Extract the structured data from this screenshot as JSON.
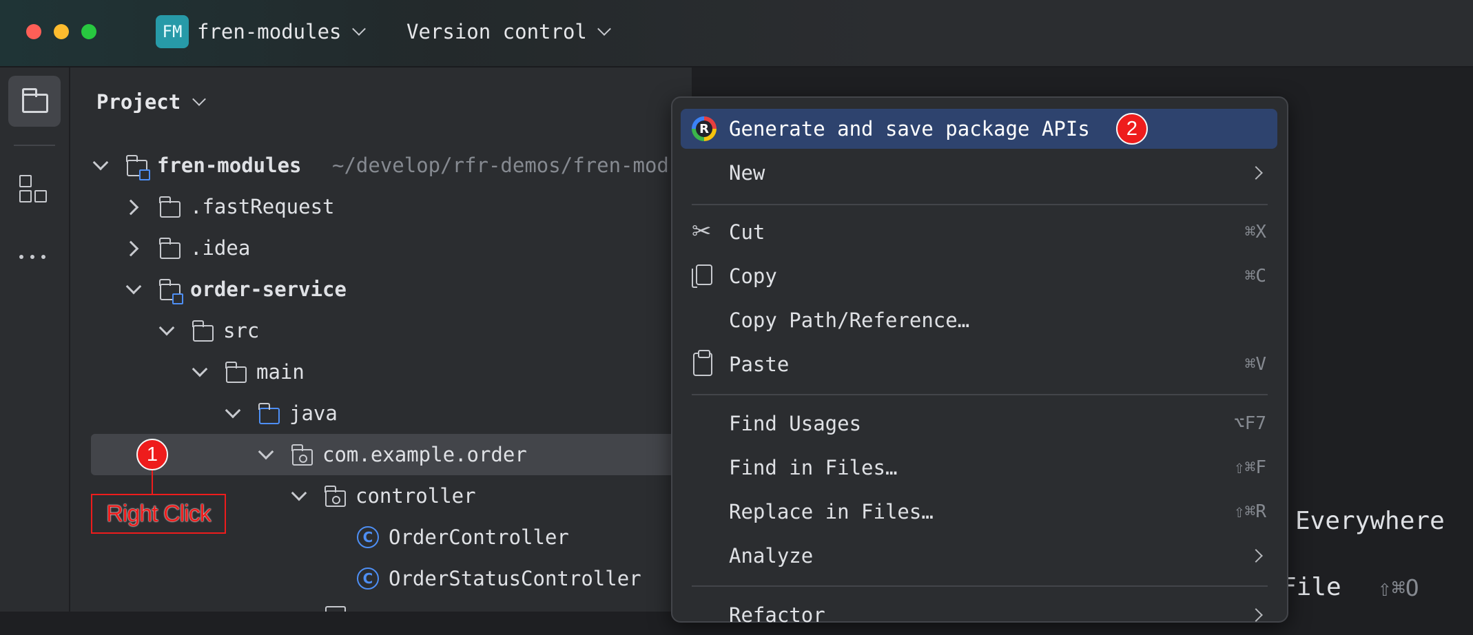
{
  "titlebar": {
    "project_badge": "FM",
    "project_name": "fren-modules",
    "vcs_label": "Version control"
  },
  "project_panel": {
    "title": "Project",
    "tree": [
      {
        "label": "fren-modules",
        "path_hint": "~/develop/rfr-demos/fren-mod"
      },
      {
        "label": ".fastRequest"
      },
      {
        "label": ".idea"
      },
      {
        "label": "order-service"
      },
      {
        "label": "src"
      },
      {
        "label": "main"
      },
      {
        "label": "java"
      },
      {
        "label": "com.example.order"
      },
      {
        "label": "controller"
      },
      {
        "label": "OrderController"
      },
      {
        "label": "OrderStatusController"
      }
    ]
  },
  "annotations": {
    "step1_number": "1",
    "step1_text": "Right Click",
    "step2_number": "2"
  },
  "context_menu": {
    "items": [
      {
        "label": "Generate and save package APIs",
        "shortcut": ""
      },
      {
        "label": "New",
        "shortcut": ""
      },
      {
        "label": "Cut",
        "shortcut": "⌘X"
      },
      {
        "label": "Copy",
        "shortcut": "⌘C"
      },
      {
        "label": "Copy Path/Reference…",
        "shortcut": ""
      },
      {
        "label": "Paste",
        "shortcut": "⌘V"
      },
      {
        "label": "Find Usages",
        "shortcut": "⌥F7"
      },
      {
        "label": "Find in Files…",
        "shortcut": "⇧⌘F"
      },
      {
        "label": "Replace in Files…",
        "shortcut": "⇧⌘R"
      },
      {
        "label": "Analyze",
        "shortcut": ""
      },
      {
        "label": "Refactor",
        "shortcut": ""
      }
    ]
  },
  "editor_hints": {
    "search_everywhere_tail": "Everywhere",
    "goto_file_tail": "File",
    "goto_file_shortcut": "⇧⌘O"
  },
  "colors": {
    "accent_selected": "#2e436e",
    "badge_red": "#ee1c1c",
    "project_badge_bg": "#279aa8"
  }
}
